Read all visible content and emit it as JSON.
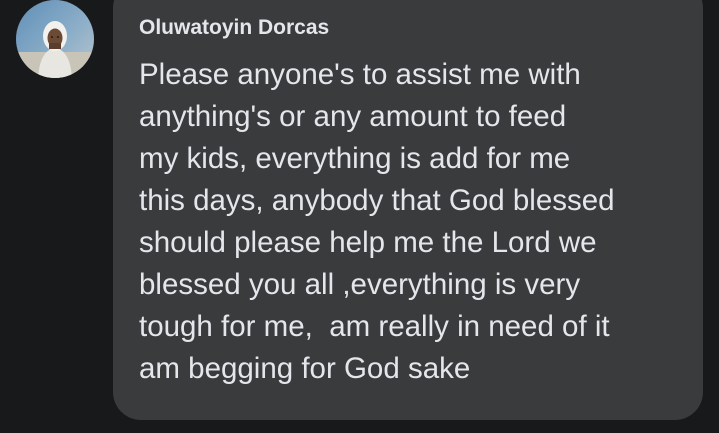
{
  "comment": {
    "author_name": "Oluwatoyin Dorcas",
    "avatar_icon": "profile-photo-icon",
    "message_lines": [
      "Please anyone's to assist me with",
      "anything's or any amount to feed",
      "my kids, everything is add for me",
      "this days, anybody that God blessed",
      "should please help me the Lord we",
      "blessed you all ,everything is very",
      "tough for me,  am really in need of it",
      "am begging for God sake"
    ]
  },
  "colors": {
    "background": "#18191a",
    "bubble": "#3a3b3c",
    "text": "#e4e6eb"
  }
}
